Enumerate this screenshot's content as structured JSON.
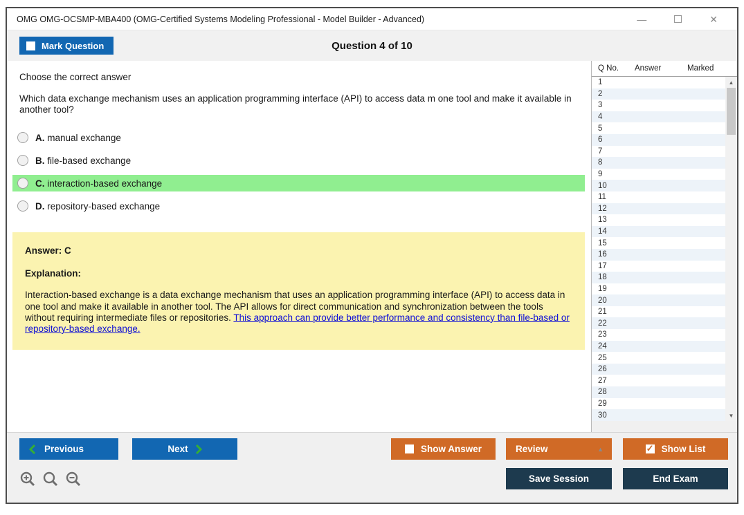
{
  "window": {
    "title": "OMG OMG-OCSMP-MBA400 (OMG-Certified Systems Modeling Professional - Model Builder - Advanced)"
  },
  "header": {
    "mark_question_label": "Mark Question",
    "question_counter": "Question 4 of 10"
  },
  "question": {
    "instruction": "Choose the correct answer",
    "text": "Which data exchange mechanism uses an application programming interface (API) to access data m one tool and make it available in another tool?",
    "options": [
      {
        "letter": "A.",
        "text": "manual exchange",
        "highlighted": false
      },
      {
        "letter": "B.",
        "text": "file-based exchange",
        "highlighted": false
      },
      {
        "letter": "C.",
        "text": "interaction-based exchange",
        "highlighted": true
      },
      {
        "letter": "D.",
        "text": "repository-based exchange",
        "highlighted": false
      }
    ]
  },
  "explanation_box": {
    "answer_label": "Answer: C",
    "explanation_label": "Explanation:",
    "body_text": "Interaction-based exchange is a data exchange mechanism that uses an application programming interface (API) to access data in one tool and make it available in another tool. The API allows for direct communication and synchronization between the tools without requiring intermediate files or repositories. ",
    "link_text": "This approach can provide better performance and consistency than file-based or repository-based exchange."
  },
  "sidebar": {
    "columns": [
      "Q No.",
      "Answer",
      "Marked"
    ],
    "rows": [
      "1",
      "2",
      "3",
      "4",
      "5",
      "6",
      "7",
      "8",
      "9",
      "10",
      "11",
      "12",
      "13",
      "14",
      "15",
      "16",
      "17",
      "18",
      "19",
      "20",
      "21",
      "22",
      "23",
      "24",
      "25",
      "26",
      "27",
      "28",
      "29",
      "30"
    ]
  },
  "footer": {
    "previous_label": "Previous",
    "next_label": "Next",
    "show_answer_label": "Show Answer",
    "review_label": "Review",
    "show_list_label": "Show List",
    "save_session_label": "Save Session",
    "end_exam_label": "End Exam"
  },
  "icons": {
    "minimize": "—",
    "close": "✕",
    "review_caret": "▲",
    "scroll_up": "▲",
    "scroll_down": "▼"
  },
  "colors": {
    "button_blue": "#1267b2",
    "button_orange": "#d06a26",
    "button_navy": "#1d3a4e",
    "highlight_green": "#90ee90",
    "explanation_yellow": "#fbf3b0",
    "link_blue": "#0f0fd6",
    "chevron_green": "#35ae35"
  }
}
